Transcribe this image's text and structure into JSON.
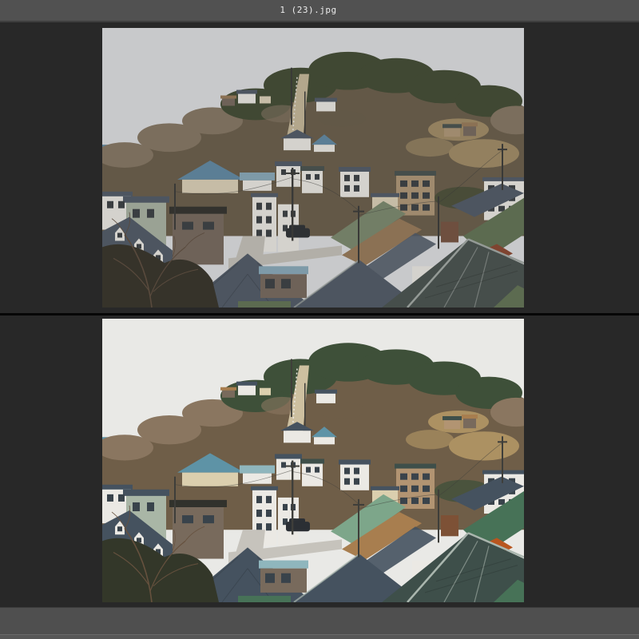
{
  "window": {
    "title": "1 (23).jpg"
  },
  "chrome": {
    "titlebar_bg": "#515151",
    "titlebar_border": "#3e3e3e",
    "title_color": "#ececec",
    "canvas_bg": "#282828",
    "divider": "#060606",
    "statusbar_bg": "#4f4f4f",
    "statusbar_lower_bg": "#575757",
    "statusbar_line": "#6a6a6a"
  },
  "scene_description": "Two stacked versions of the same photograph: an overlook of a Japanese hillside town, tree-covered hill with a stair path behind dense small houses, streets and tiled roofs in front. Top copy is flat and desaturated; bottom copy is brighter with teal-green color grading.",
  "photos": [
    {
      "name": "photo-top",
      "palette": {
        "sky": "#c8c9cb",
        "hillBase": "#635847",
        "hillBare": "#7b6e5d",
        "hillTrees": "#404833",
        "scrub": "#93805f",
        "stairPath": "#b3a78c",
        "wallWhite": "#d4d2cd",
        "wallCream": "#c6bca6",
        "wallTan": "#9f8a6e",
        "wallSage": "#9aa294",
        "wallDark": "#6e6258",
        "wallBrick": "#6e4f3f",
        "roofBlue": "#5b7e95",
        "roofBlueLight": "#7e9aa8",
        "roofSlate": "#4d5560",
        "roofDark": "#464e4b",
        "roofGreenBig": "#5c6b50",
        "roofGreenLight": "#727e66",
        "roofRust": "#8b7154",
        "roofOrange": "#7f4430",
        "roofFlat": "#33322e",
        "road": "#b2afa8",
        "car": "#2e3134",
        "window": "#3a3e41",
        "ridge": "#949a96",
        "foliageDark": "#36332a",
        "branches": "#594a3d",
        "pole": "#393937"
      }
    },
    {
      "name": "photo-bottom",
      "palette": {
        "sky": "#e9e9e6",
        "hillBase": "#6f5e48",
        "hillBare": "#8a7660",
        "hillTrees": "#3e5039",
        "scrub": "#ac9162",
        "stairPath": "#cdc0a0",
        "wallWhite": "#ebe9e4",
        "wallCream": "#dbcfae",
        "wallTan": "#b29472",
        "wallSage": "#a9b6a6",
        "wallDark": "#786a5c",
        "wallBrick": "#7d5136",
        "roofBlue": "#5e93a6",
        "roofBlueLight": "#8fb6bd",
        "roofSlate": "#45525f",
        "roofDark": "#3e4f4a",
        "roofGreenBig": "#477257",
        "roofGreenLight": "#7da68a",
        "roofRust": "#a87e4f",
        "roofOrange": "#b9561f",
        "roofFlat": "#31322c",
        "road": "#c6c3bc",
        "car": "#2b2f34",
        "window": "#39434b",
        "ridge": "#aab6ae",
        "foliageDark": "#333729",
        "branches": "#66513e",
        "pole": "#3e3e3a"
      }
    }
  ]
}
